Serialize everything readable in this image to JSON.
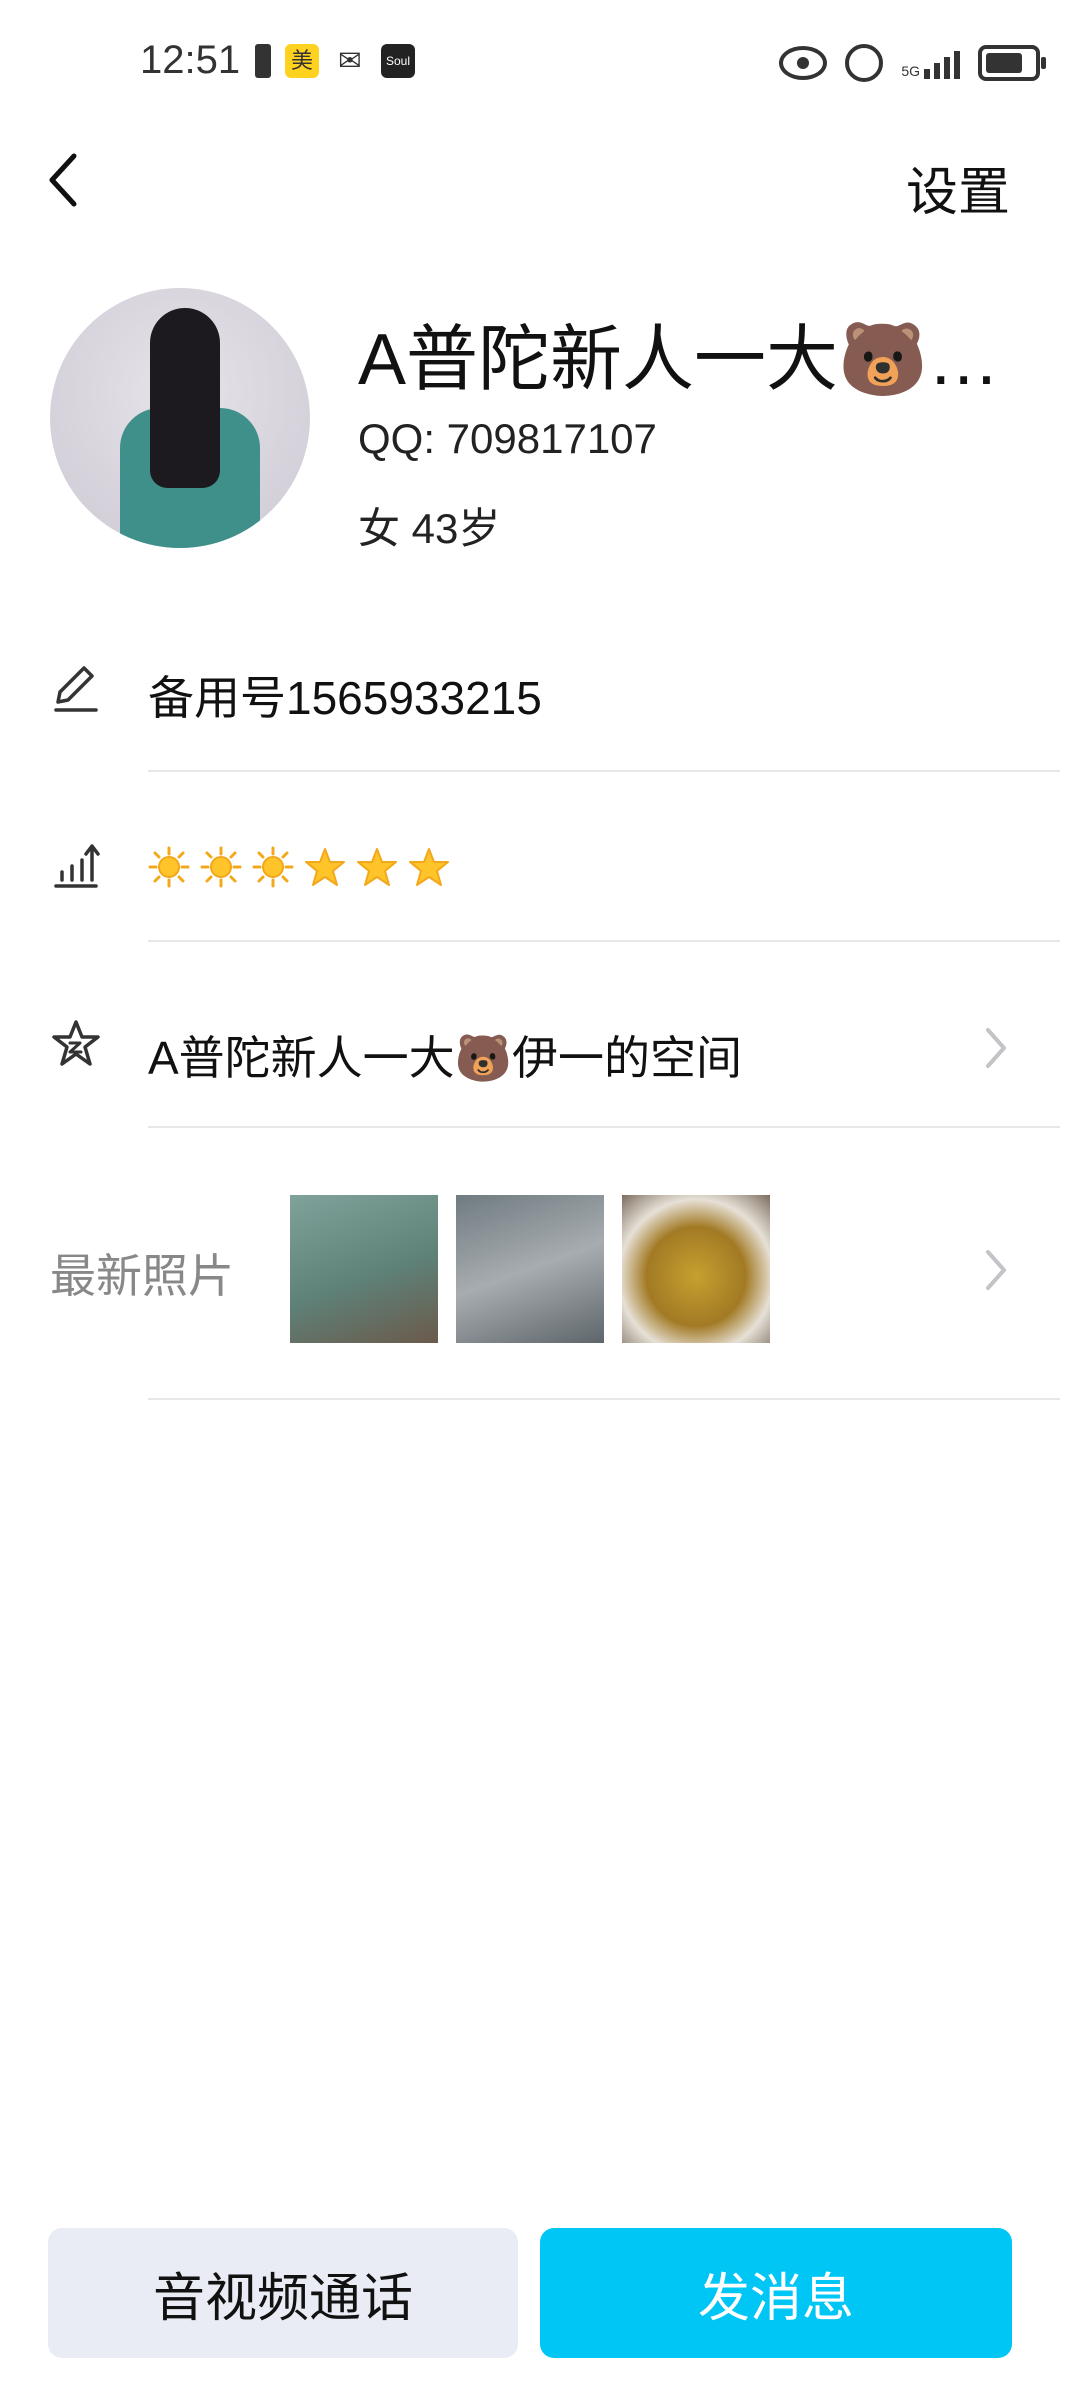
{
  "status_bar": {
    "time": "12:51",
    "left_icons": [
      "battery-saver-icon",
      "meituan-icon",
      "wechat-icon",
      "soul-icon"
    ],
    "meituan_label": "美",
    "soul_label": "Soul",
    "right_icons": [
      "eye-icon",
      "alarm-icon",
      "signal-5g-icon",
      "battery-icon"
    ],
    "network": "5G"
  },
  "header": {
    "back_icon": "chevron-left-icon",
    "settings_label": "设置"
  },
  "profile": {
    "name": "A普陀新人一大🐻…",
    "qq": "QQ: 709817107",
    "info": "女 43岁"
  },
  "rows": {
    "backup_number": "备用号1565933215",
    "level_stars": [
      "sun",
      "sun",
      "sun",
      "star",
      "star",
      "star"
    ],
    "space_label": "A普陀新人一大🐻伊一的空间",
    "photos_label": "最新照片"
  },
  "buttons": {
    "call_label": "音视频通话",
    "message_label": "发消息"
  },
  "colors": {
    "accent": "#00c6f5",
    "secondary_button": "#e9ecf5",
    "divider": "#e7e7ea",
    "muted_text": "#888888"
  }
}
